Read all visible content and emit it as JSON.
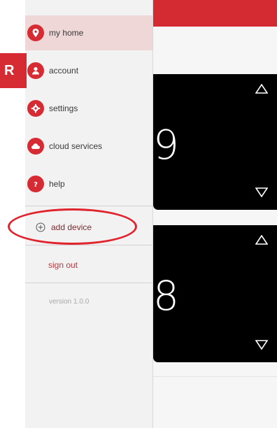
{
  "badge": {
    "letter": "R"
  },
  "menu": {
    "items": [
      {
        "label": "my home",
        "icon": "location-pin-icon",
        "active": true
      },
      {
        "label": "account",
        "icon": "user-icon",
        "active": false
      },
      {
        "label": "settings",
        "icon": "gear-icon",
        "active": false
      },
      {
        "label": "cloud services",
        "icon": "cloud-icon",
        "active": false
      },
      {
        "label": "help",
        "icon": "question-icon",
        "active": false
      }
    ],
    "add_device": "add device",
    "sign_out": "sign out",
    "version": "version 1.0.0"
  },
  "thermostats": [
    {
      "value": "9"
    },
    {
      "value": "8"
    }
  ],
  "colors": {
    "accent": "#d62b33",
    "highlight": "#e0232d"
  }
}
